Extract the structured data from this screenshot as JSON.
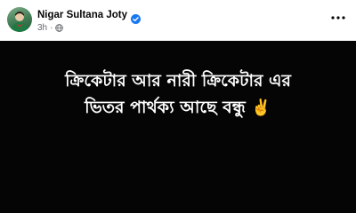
{
  "post": {
    "author_name": "Nigar Sultana Joty",
    "time": "3h",
    "audience_icon": "globe-icon",
    "verified_icon": "verified-badge-icon",
    "more_icon": "more-options-icon"
  },
  "image": {
    "line1": "ক্রিকেটার আর নারী ক্রিকেটার এর",
    "line2": "ভিতর পার্থক্য আছে বন্ধু",
    "emoji": "✌️"
  },
  "colors": {
    "verified_blue": "#1877f2",
    "meta_gray": "#65676b",
    "image_bg": "#050505",
    "image_text": "#ffffff"
  }
}
